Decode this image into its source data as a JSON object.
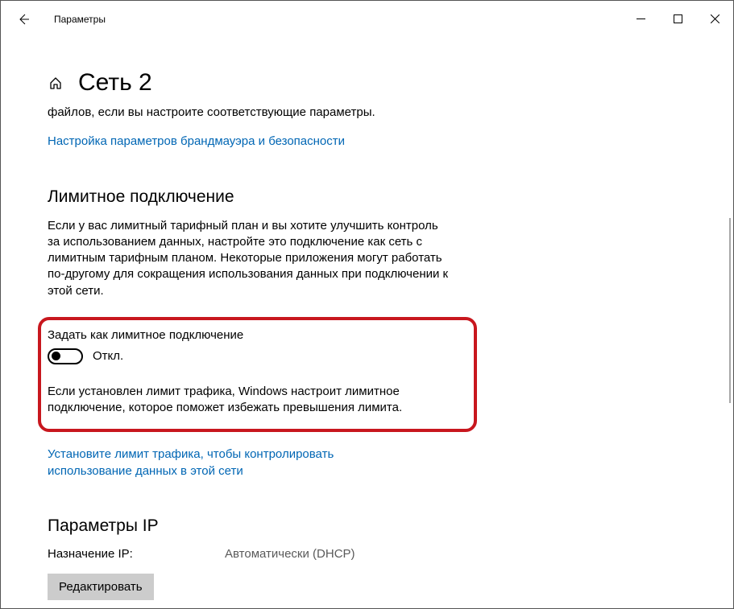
{
  "window": {
    "title": "Параметры"
  },
  "header": {
    "page_title": "Сеть 2"
  },
  "intro": {
    "text_fragment": "файлов, если вы настроите соответствующие параметры.",
    "firewall_link": "Настройка параметров брандмауэра и безопасности"
  },
  "metered": {
    "heading": "Лимитное подключение",
    "description": "Если у вас лимитный тарифный план и вы хотите улучшить контроль за использованием данных, настройте это подключение как сеть с лимитным тарифным планом. Некоторые приложения могут работать по-другому для сокращения использования данных при подключении к этой сети.",
    "toggle_label": "Задать как лимитное подключение",
    "toggle_state": "Откл.",
    "toggle_desc": "Если установлен лимит трафика, Windows настроит лимитное подключение, которое поможет избежать превышения лимита.",
    "data_limit_link": "Установите лимит трафика, чтобы контролировать использование данных в этой сети"
  },
  "ip": {
    "heading": "Параметры IP",
    "assignment_label": "Назначение IP:",
    "assignment_value": "Автоматически (DHCP)",
    "edit_button": "Редактировать"
  }
}
